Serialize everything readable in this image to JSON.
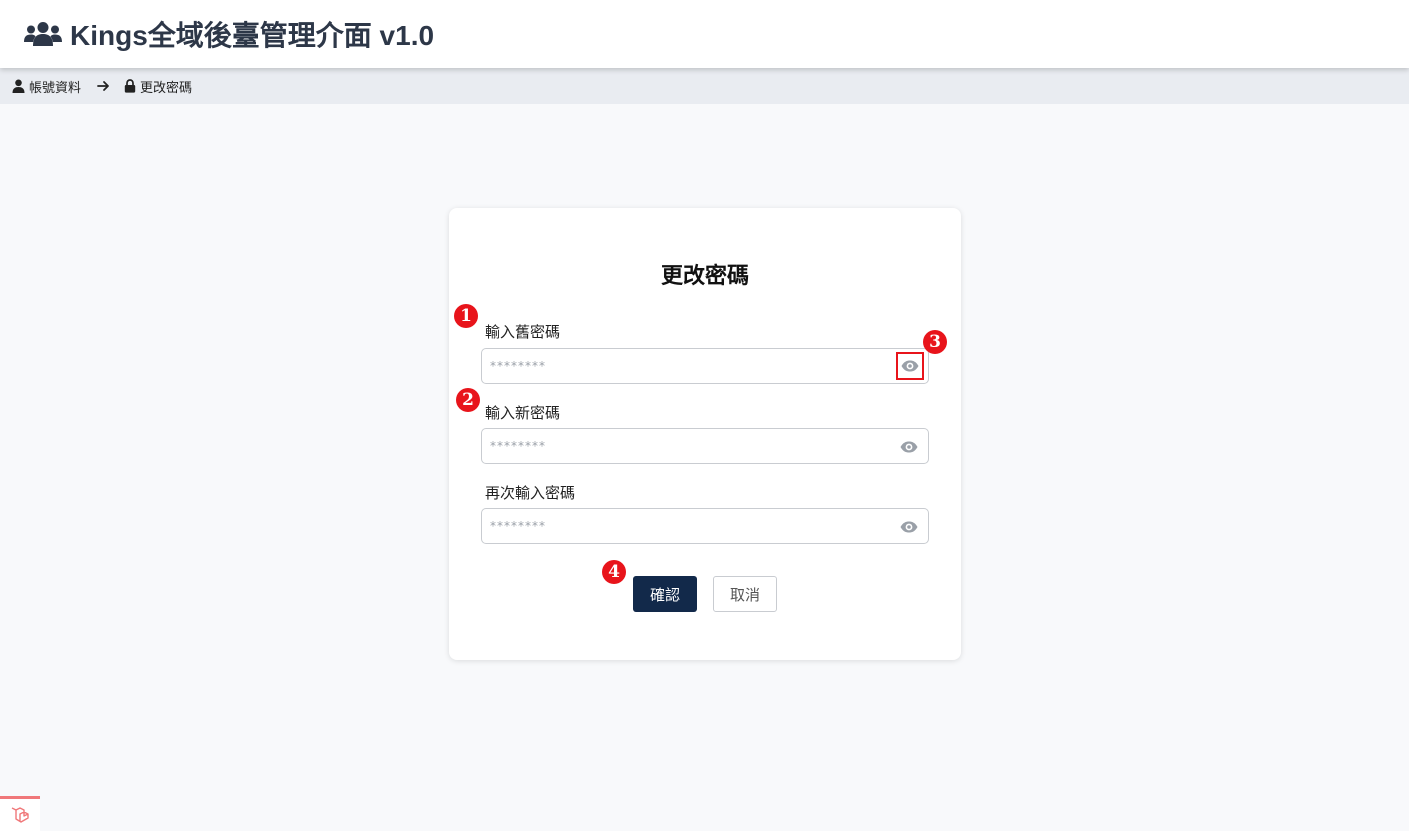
{
  "header": {
    "title": "Kings全域後臺管理介面 v1.0",
    "icon": "users-icon"
  },
  "breadcrumb": {
    "items": [
      {
        "label": "帳號資料",
        "icon": "user-icon"
      },
      {
        "label": "更改密碼",
        "icon": "lock-icon"
      }
    ],
    "separator_icon": "arrow-right-icon"
  },
  "form": {
    "title": "更改密碼",
    "fields": [
      {
        "label": "輸入舊密碼",
        "placeholder": "********",
        "toggle_icon": "eye-icon"
      },
      {
        "label": "輸入新密碼",
        "placeholder": "********",
        "toggle_icon": "eye-icon"
      },
      {
        "label": "再次輸入密碼",
        "placeholder": "********",
        "toggle_icon": "eye-icon"
      }
    ],
    "confirm_label": "確認",
    "cancel_label": "取消"
  },
  "annotations": {
    "markers": [
      "1",
      "2",
      "3",
      "4"
    ],
    "color": "#e8141b"
  },
  "colors": {
    "primary": "#12294a",
    "header_text": "#2d3748",
    "breadcrumb_bg": "#e9ecf1",
    "logo_accent": "#f0787a"
  }
}
